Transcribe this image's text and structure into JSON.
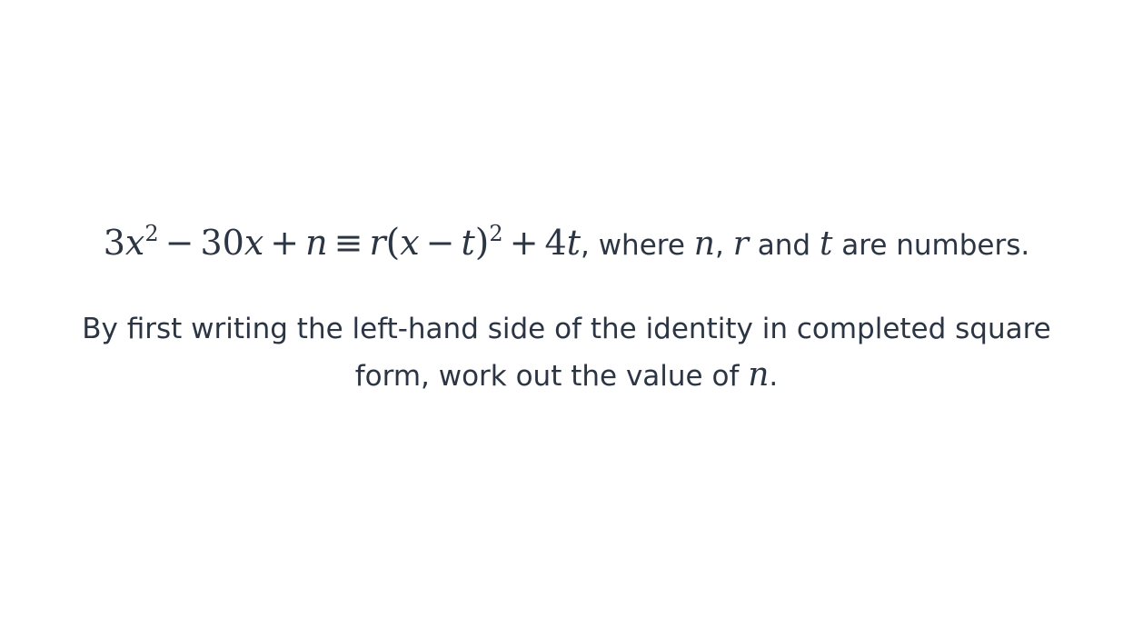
{
  "question": {
    "equation": {
      "coef_a": "3",
      "var_x": "x",
      "exp_2": "2",
      "minus": "−",
      "coef_b": "30",
      "var_x2": "x",
      "plus": "+",
      "var_n": "n",
      "equiv": "≡",
      "var_r": "r",
      "lparen": "(",
      "var_x3": "x",
      "minus2": "−",
      "var_t": "t",
      "rparen": ")",
      "exp_2b": "2",
      "plus2": "+",
      "coef_c": "4",
      "var_t2": "t"
    },
    "where_text": ", where ",
    "var_n": "n",
    "comma": ", ",
    "var_r": "r",
    "and_text": " and ",
    "var_t": "t",
    "tail_text": " are numbers.",
    "instruction_line_1": "By first writing the left-hand side of the identity in completed square",
    "instruction_line_2_prefix": "form, work out the value of ",
    "instruction_var": "n",
    "instruction_end": "."
  }
}
